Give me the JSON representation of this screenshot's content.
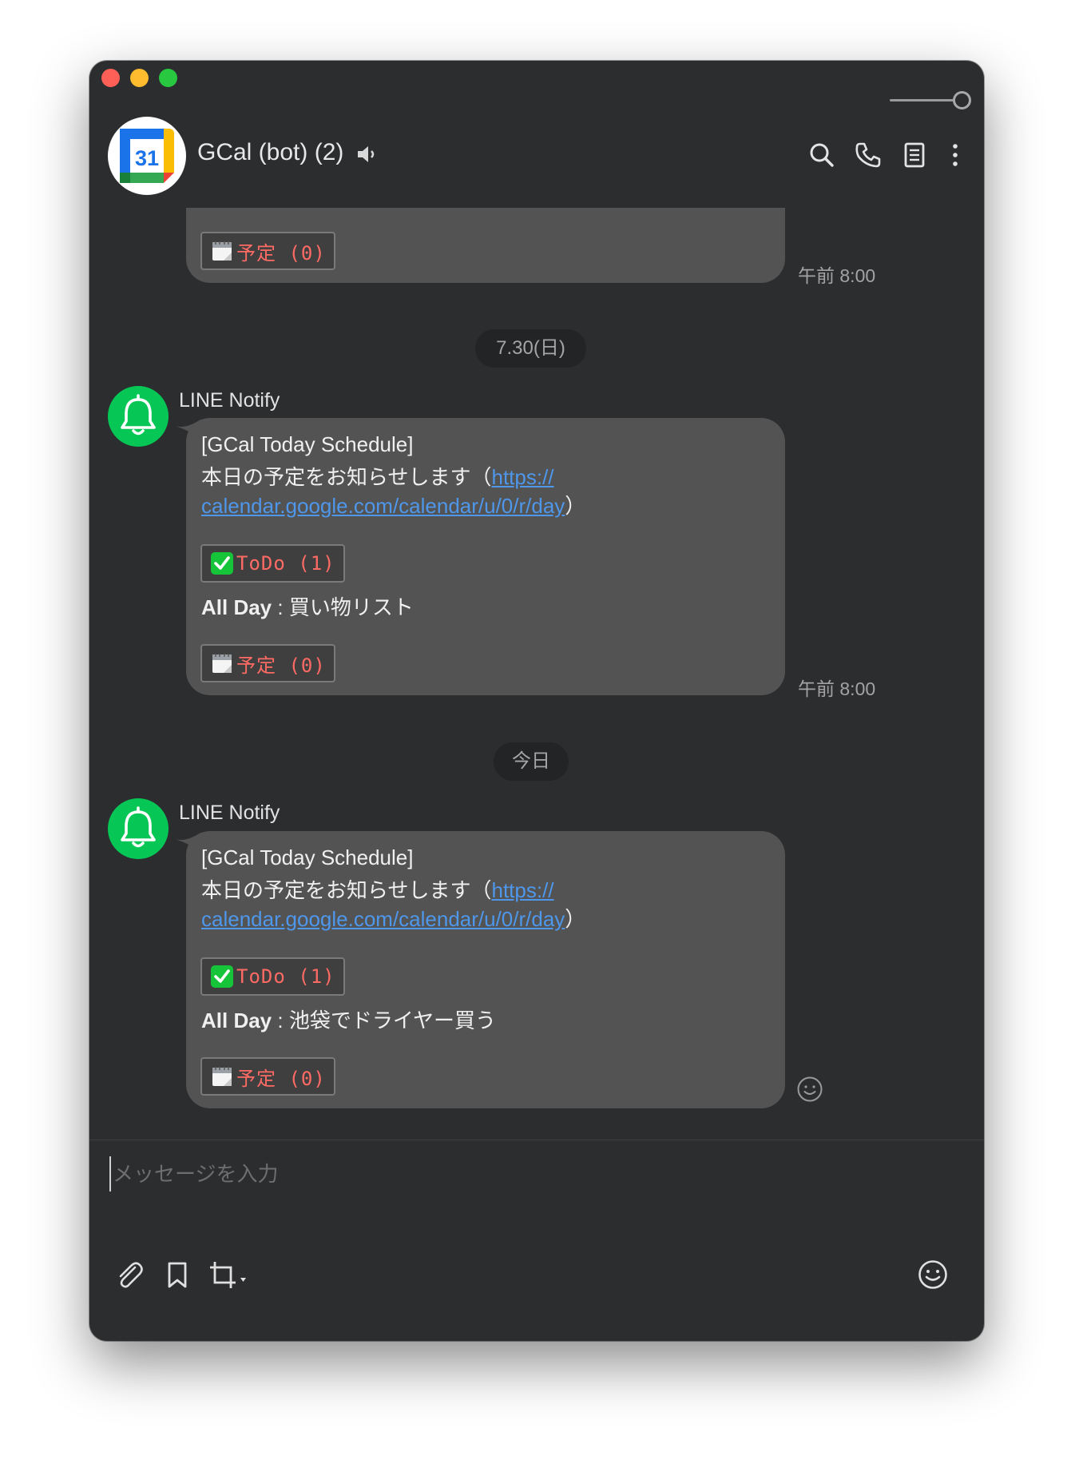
{
  "header": {
    "title": "GCal (bot) (2)",
    "avatar_icon": "google-calendar-icon",
    "avatar_text": "31",
    "actions": [
      "search-icon",
      "phone-icon",
      "notes-icon",
      "more-icon"
    ]
  },
  "history": {
    "partial_message": {
      "plan_tag": "予定 (0)",
      "timestamp": "午前 8:00"
    },
    "date_labels": [
      "7.30(日)",
      "今日"
    ]
  },
  "messages": [
    {
      "sender": "LINE Notify",
      "title": "[GCal Today Schedule]",
      "text_prefix": "本日の予定をお知らせします（",
      "link_part1": "https://",
      "link_part2": "calendar.google.com/calendar/u/0/r/day",
      "text_suffix": "）",
      "todo_tag": "ToDo (1)",
      "allday_label": "All Day",
      "allday_value": " : 買い物リスト",
      "plan_tag": "予定 (0)",
      "timestamp": "午前 8:00"
    },
    {
      "sender": "LINE Notify",
      "title": "[GCal Today Schedule]",
      "text_prefix": "本日の予定をお知らせします（",
      "link_part1": "https://",
      "link_part2": "calendar.google.com/calendar/u/0/r/day",
      "text_suffix": "）",
      "todo_tag": "ToDo (1)",
      "allday_label": "All Day",
      "allday_value": " : 池袋でドライヤー買う",
      "plan_tag": "予定 (0)",
      "reaction_icon": "smiley-icon"
    }
  ],
  "composer": {
    "placeholder": "メッセージを入力",
    "toolbar": [
      "paperclip-icon",
      "bookmark-icon",
      "crop-icon",
      "emoji-icon"
    ]
  },
  "colors": {
    "window_bg": "#2c2d2f",
    "bubble_bg": "#535354",
    "link": "#4e97ea",
    "tag_text": "#ff6b64",
    "line_green": "#06c755"
  }
}
